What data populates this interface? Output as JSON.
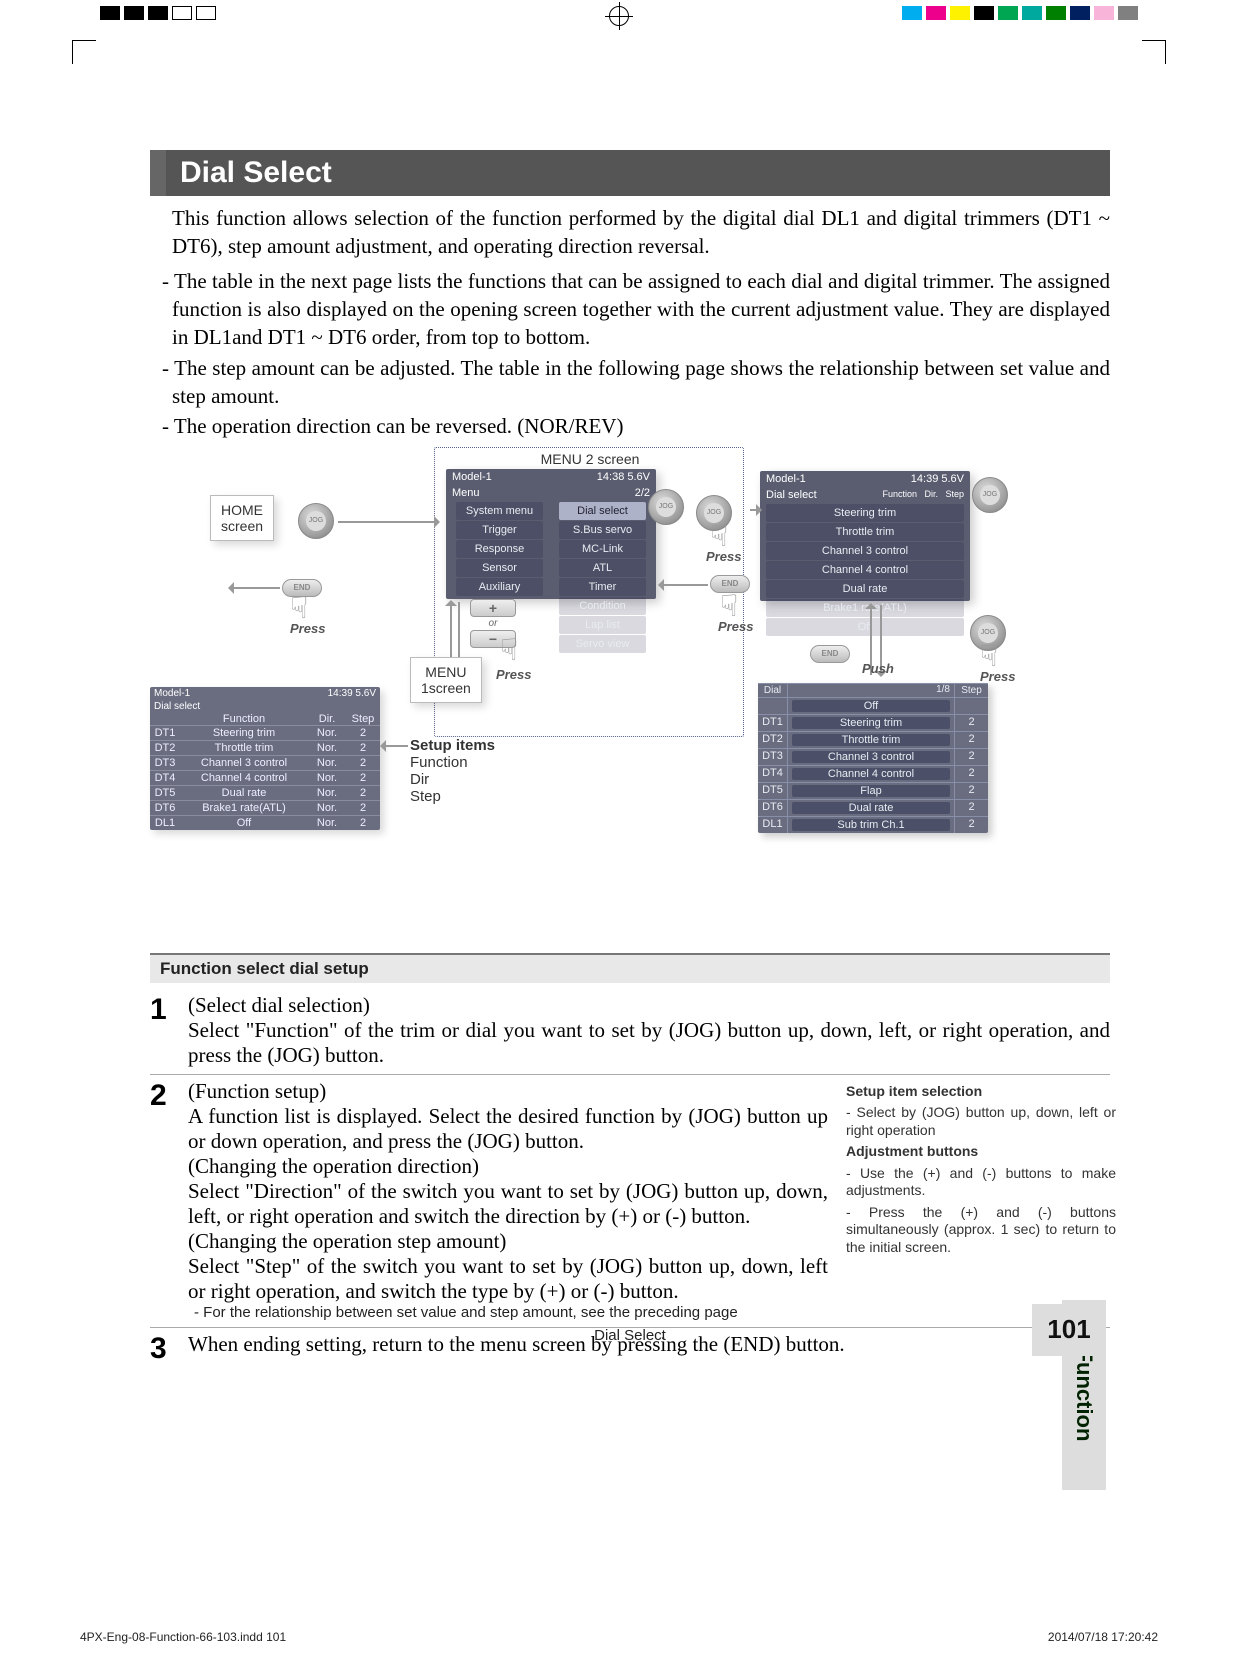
{
  "heading": "Dial Select",
  "intro": "This function allows selection of the function performed by the digital dial DL1 and digital trimmers (DT1 ~ DT6), step amount adjustment, and operating direction reversal.",
  "bullets": [
    "- The table in the next page lists the functions that can be assigned to each dial and digital trimmer. The assigned function is also displayed on the opening screen together with the current adjustment value. They are displayed in DL1and DT1 ~ DT6 order, from top to bottom.",
    "- The step amount can be adjusted. The table in the following page shows the relationship between set value and step amount.",
    "- The operation direction can be reversed. (NOR/REV)"
  ],
  "diagram": {
    "menu2_label": "MENU 2 screen",
    "home_label_1": "HOME",
    "home_label_2": "screen",
    "menu1_label_1": "MENU",
    "menu1_label_2": "1screen",
    "press": "Press",
    "push": "Push",
    "plus": "+",
    "or": "or",
    "minus": "−",
    "end": "END",
    "jog": "JOG",
    "menu2_items": [
      "System menu",
      "Trigger",
      "Response",
      "Sensor",
      "Auxiliary"
    ],
    "menu2_items_b": [
      "Dial select",
      "S.Bus servo",
      "MC-Link",
      "ATL",
      "Timer",
      "Condition",
      "Lap list",
      "Servo view"
    ],
    "menu2_title_time": "14:38  5.6V",
    "menu2_page": "2/2",
    "func_list": [
      "Steering trim",
      "Throttle trim",
      "Channel 3 control",
      "Channel 4 control",
      "Dual rate",
      "Brake1 rate(ATL)",
      "Off"
    ],
    "dial_header": {
      "left": "Model-1",
      "right": "14:39  5.6V",
      "title": "Dial select"
    },
    "dial_cols": [
      "",
      "Function",
      "Dir.",
      "Step"
    ],
    "dial_rows": [
      {
        "id": "DT1",
        "fn": "Steering trim",
        "dir": "Nor.",
        "step": "2"
      },
      {
        "id": "DT2",
        "fn": "Throttle trim",
        "dir": "Nor.",
        "step": "2"
      },
      {
        "id": "DT3",
        "fn": "Channel 3 control",
        "dir": "Nor.",
        "step": "2"
      },
      {
        "id": "DT4",
        "fn": "Channel 4 control",
        "dir": "Nor.",
        "step": "2"
      },
      {
        "id": "DT5",
        "fn": "Dual rate",
        "dir": "Nor.",
        "step": "2"
      },
      {
        "id": "DT6",
        "fn": "Brake1 rate(ATL)",
        "dir": "Nor.",
        "step": "2"
      },
      {
        "id": "DL1",
        "fn": "Off",
        "dir": "Nor.",
        "step": "2"
      }
    ],
    "right_header": {
      "left": "Model-1",
      "right": "5.6V",
      "dial": "Dial",
      "page": "1/8",
      "step": "Step"
    },
    "right_rows": [
      {
        "id": "",
        "fn": "Off",
        "step": ""
      },
      {
        "id": "DT1",
        "fn": "Steering trim",
        "step": "2"
      },
      {
        "id": "DT2",
        "fn": "Throttle trim",
        "step": "2"
      },
      {
        "id": "DT3",
        "fn": "Channel 3 control",
        "step": "2"
      },
      {
        "id": "DT4",
        "fn": "Channel 4 control",
        "step": "2"
      },
      {
        "id": "DT5",
        "fn": "Flap",
        "step": "2"
      },
      {
        "id": "DT6",
        "fn": "Dual rate",
        "step": "2"
      },
      {
        "id": "DL1",
        "fn": "Sub trim Ch.1",
        "step": "2"
      }
    ],
    "setup_items_title": "Setup items",
    "setup_items": [
      "Function",
      "Dir",
      "Step"
    ]
  },
  "func_sel": "Function select dial setup",
  "steps": {
    "s1_lead": "(Select dial selection)",
    "s1_body": "Select \"Function\" of the trim or dial you want to set by (JOG) button up, down, left, or right operation, and press the (JOG) button.",
    "s2_lead": "(Function setup)",
    "s2_p1": "A function list is displayed. Select the desired function by (JOG) button up or down operation, and press the (JOG) button.",
    "s2_sub1": "(Changing the operation direction)",
    "s2_p2": "Select \"Direction\" of the switch you want to set by (JOG) button up, down, left, or right operation and switch the direction by (+) or (-) button.",
    "s2_sub2": "(Changing the operation step amount)",
    "s2_p3": "Select \"Step\" of the switch you want to set by (JOG) button up, down, left or right  operation, and switch the type by (+) or (-) button.",
    "s2_note": "- For the relationship between set value and step amount, see the preceding page",
    "s3_body": "When ending setting, return to the menu screen by pressing the (END) button."
  },
  "sidebox": {
    "t1": "Setup item selection",
    "p1": "- Select by (JOG) button up, down, left or right operation",
    "t2": "Adjustment buttons",
    "p2": "- Use the (+) and (-) buttons to make adjustments.",
    "p3": "- Press the (+) and (-) buttons simultaneously (approx. 1 sec) to return to the initial screen."
  },
  "side_tab": "Function",
  "page_number": "101",
  "footer_center": "Dial Select",
  "file_stamp_left": "4PX-Eng-08-Function-66-103.indd   101",
  "file_stamp_right": "2014/07/18   17:20:42",
  "reg_colors_left": [
    "#000",
    "#000",
    "#000",
    "#fff",
    "#fff"
  ],
  "reg_colors_right": [
    "#00aeef",
    "#ec008c",
    "#fff200",
    "#000",
    "#00a651",
    "#00a99d",
    "#008000",
    "#002060",
    "#f8b4d9",
    "#808080"
  ]
}
